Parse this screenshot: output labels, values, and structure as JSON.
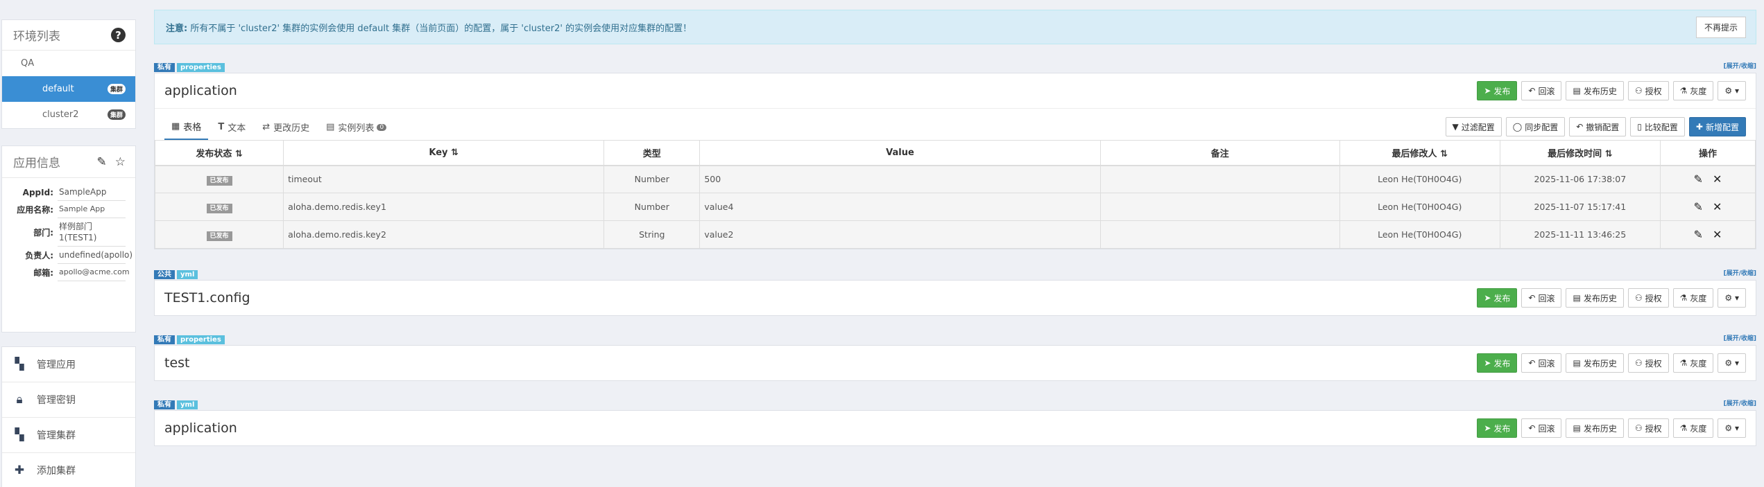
{
  "env": {
    "title": "环境列表",
    "items": [
      {
        "label": "QA"
      },
      {
        "label": "default",
        "badge": "集群"
      },
      {
        "label": "cluster2",
        "badge": "集群"
      }
    ]
  },
  "app_info": {
    "title": "应用信息",
    "rows": [
      {
        "k": "AppId:",
        "v": "SampleApp"
      },
      {
        "k": "应用名称:",
        "v": "Sample App"
      },
      {
        "k": "部门:",
        "v": "样例部门1(TEST1)"
      },
      {
        "k": "负责人:",
        "v": "undefined(apollo)"
      },
      {
        "k": "邮箱:",
        "v": "apollo@acme.com"
      }
    ]
  },
  "menu": [
    {
      "label": "管理应用",
      "icon": "grid-icon"
    },
    {
      "label": "管理密钥",
      "icon": "lock-icon"
    },
    {
      "label": "管理集群",
      "icon": "grid-icon"
    },
    {
      "label": "添加集群",
      "icon": "plus-icon"
    }
  ],
  "alert": {
    "prefix": "注意:",
    "text": " 所有不属于 'cluster2' 集群的实例会使用 default 集群（当前页面）的配置，属于 'cluster2' 的实例会使用对应集群的配置！",
    "dismiss": "不再提示"
  },
  "actions": {
    "publish": "发布",
    "rollback": "回滚",
    "history": "发布历史",
    "grant": "授权",
    "gray": "灰度",
    "fold": "[展开/收缩]"
  },
  "tabs": {
    "table": "表格",
    "text": "文本",
    "history": "更改历史",
    "instances": "实例列表",
    "instances_count": "0"
  },
  "table_btns": {
    "filter": "过滤配置",
    "sync": "同步配置",
    "revoke": "撤销配置",
    "compare": "比较配置",
    "add": "新增配置"
  },
  "table": {
    "headers": [
      "发布状态",
      "Key",
      "类型",
      "Value",
      "备注",
      "最后修改人",
      "最后修改时间",
      "操作"
    ],
    "rows": [
      {
        "status": "已发布",
        "key": "timeout",
        "type": "Number",
        "value": "500",
        "comment": "",
        "modifier": "Leon He(T0H0O4G)",
        "time": "2025-11-06 17:38:07"
      },
      {
        "status": "已发布",
        "key": "aloha.demo.redis.key1",
        "type": "Number",
        "value": "value4",
        "comment": "",
        "modifier": "Leon He(T0H0O4G)",
        "time": "2025-11-07 15:17:41"
      },
      {
        "status": "已发布",
        "key": "aloha.demo.redis.key2",
        "type": "String",
        "value": "value2",
        "comment": "",
        "modifier": "Leon He(T0H0O4G)",
        "time": "2025-11-11 13:46:25"
      }
    ]
  },
  "namespaces": [
    {
      "scope": "私有",
      "format": "properties",
      "name": "application"
    },
    {
      "scope": "公共",
      "format": "yml",
      "name": "TEST1.config"
    },
    {
      "scope": "私有",
      "format": "properties",
      "name": "test"
    },
    {
      "scope": "私有",
      "format": "yml",
      "name": "application"
    }
  ]
}
